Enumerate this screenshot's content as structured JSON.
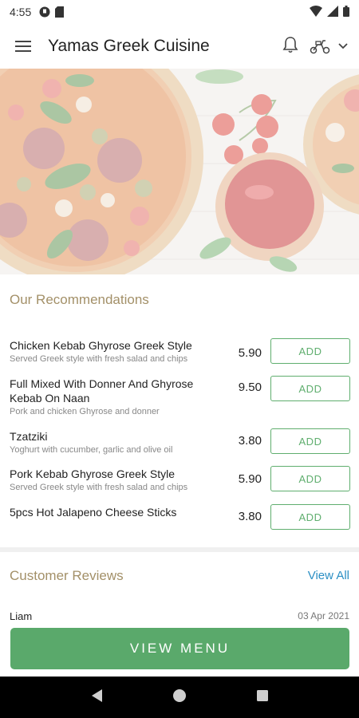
{
  "status_bar": {
    "time": "4:55"
  },
  "app_bar": {
    "title": "Yamas Greek Cuisine"
  },
  "recommendations": {
    "title": "Our Recommendations",
    "items": [
      {
        "name": "Chicken Kebab Ghyrose Greek Style",
        "description": "Served Greek style with fresh salad and chips",
        "price": "5.90",
        "button": "ADD"
      },
      {
        "name": "Full Mixed With Donner And Ghyrose Kebab On Naan",
        "description": "Pork and chicken Ghyrose and donner",
        "price": "9.50",
        "button": "ADD"
      },
      {
        "name": "Tzatziki",
        "description": "Yoghurt with cucumber, garlic and olive oil",
        "price": "3.80",
        "button": "ADD"
      },
      {
        "name": "Pork Kebab Ghyrose Greek Style",
        "description": "Served Greek style with fresh salad and chips",
        "price": "5.90",
        "button": "ADD"
      },
      {
        "name": "5pcs Hot Jalapeno Cheese Sticks",
        "description": "",
        "price": "3.80",
        "button": "ADD"
      }
    ]
  },
  "reviews": {
    "title": "Customer Reviews",
    "view_all": "View All",
    "first": {
      "name": "Liam",
      "date": "03 Apr 2021"
    }
  },
  "cta": {
    "label": "VIEW MENU"
  },
  "colors": {
    "accent_green": "#5aa96b",
    "section_gold": "#a39068",
    "link_blue": "#2b8fc4"
  },
  "icons": [
    "menu-icon",
    "bell-icon",
    "scooter-icon",
    "chevron-down-icon",
    "wifi-icon",
    "signal-icon",
    "battery-icon",
    "back-icon",
    "home-icon",
    "recents-icon"
  ]
}
